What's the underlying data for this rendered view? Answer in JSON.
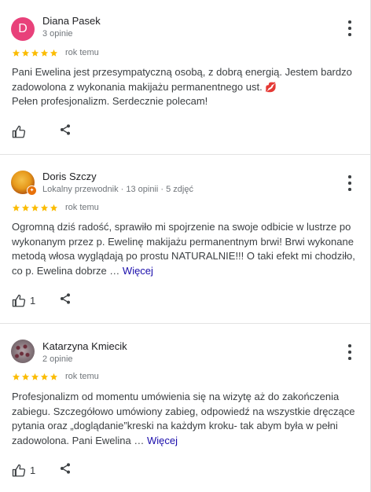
{
  "reviews": [
    {
      "avatar_letter": "D",
      "avatar_color": "#e8417a",
      "name": "Diana Pasek",
      "meta": "3 opinie",
      "rating": 5,
      "date": "rok temu",
      "text_lines": [
        "Pani Ewelina jest przesympatyczną osobą, z dobrą energią. Jestem bardzo zadowolona z wykonania makijażu permanentnego ust.",
        "Pełen profesjonalizm. Serdecznie polecam!"
      ],
      "emoji": "💋",
      "more": "",
      "likes": ""
    },
    {
      "avatar_letter": "",
      "name": "Doris Szczy",
      "meta": "Lokalny przewodnik · 13 opinii · 5 zdjęć",
      "rating": 5,
      "date": "rok temu",
      "text_lines": [
        "Ogromną dziś radość, sprawiło mi spojrzenie na swoje odbicie w lustrze po wykonanym przez p. Ewelinę makijażu permanentnym brwi! Brwi wykonane metodą włosa wyglądają po prostu NATURALNIE!!! O taki efekt mi chodziło, co p. Ewelina dobrze …"
      ],
      "emoji": "",
      "more": "Więcej",
      "likes": "1"
    },
    {
      "avatar_letter": "",
      "name": "Katarzyna Kmiecik",
      "meta": "2 opinie",
      "rating": 5,
      "date": "rok temu",
      "text_lines": [
        "Profesjonalizm od momentu umówienia się na wizytę aż do zakończenia zabiegu. Szczegółowo umówiony zabieg, odpowiedź na wszystkie dręczące pytania oraz „doglądanie”kreski na każdym kroku- tak abym była w pełni zadowolona. Pani Ewelina …"
      ],
      "emoji": "",
      "more": "Więcej",
      "likes": "1"
    }
  ],
  "colors": {
    "star": "#fbbc04",
    "link": "#1a0dab",
    "text": "#3c4043",
    "secondary": "#70757a"
  },
  "icons": {
    "menu": "more-vert-icon",
    "like": "thumb-up-icon",
    "share": "share-icon",
    "star": "star-icon",
    "guide_badge": "local-guide-badge-icon"
  }
}
